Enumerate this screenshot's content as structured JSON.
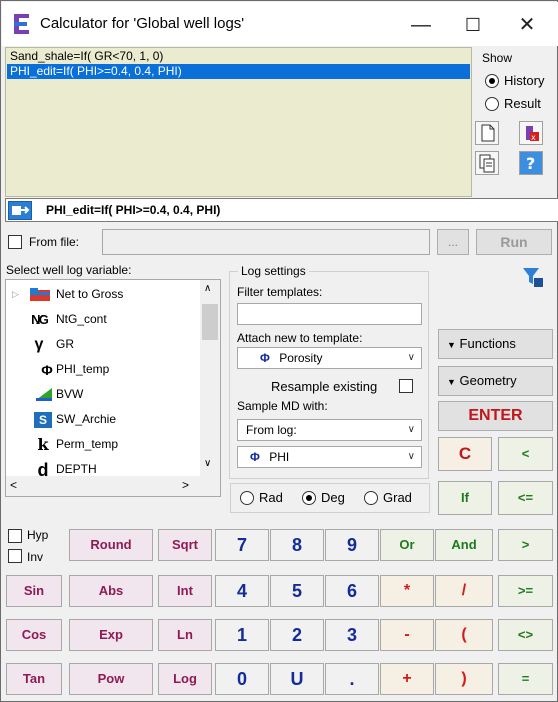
{
  "window": {
    "title": "Calculator for 'Global well logs'",
    "min": "—",
    "max": "☐",
    "close": "✕"
  },
  "formulas": [
    "Sand_shale=If( GR<70, 1, 0)",
    "PHI_edit=If( PHI>=0.4, 0.4, PHI)"
  ],
  "show": {
    "label": "Show",
    "history": "History",
    "result": "Result",
    "selected": "History"
  },
  "expression": "PHI_edit=If( PHI>=0.4, 0.4, PHI)",
  "from_file": {
    "label": "From file:",
    "browse": "...",
    "run": "Run"
  },
  "variables": {
    "label": "Select well log variable:",
    "items": [
      {
        "name": "Net to Gross",
        "icon": "folder-icon"
      },
      {
        "name": "NtG_cont",
        "icon": "ntg-icon"
      },
      {
        "name": "GR",
        "icon": "gamma-icon"
      },
      {
        "name": "PHI_temp",
        "icon": "phi-icon"
      },
      {
        "name": "BVW",
        "icon": "bvw-icon"
      },
      {
        "name": "SW_Archie",
        "icon": "sw-icon"
      },
      {
        "name": "Perm_temp",
        "icon": "perm-icon"
      },
      {
        "name": "DEPTH",
        "icon": "depth-icon"
      }
    ]
  },
  "log_settings": {
    "label": "Log settings",
    "filter_label": "Filter templates:",
    "filter_value": "",
    "attach_label": "Attach new to template:",
    "attach_value": "Porosity",
    "resample_label": "Resample existing",
    "sample_label": "Sample MD with:",
    "sample_value": "From log:",
    "log_value": "PHI"
  },
  "side": {
    "functions": "Functions",
    "geometry": "Geometry",
    "enter": "ENTER"
  },
  "angle": {
    "rad": "Rad",
    "deg": "Deg",
    "grad": "Grad",
    "selected": "Deg"
  },
  "toggles": {
    "hyp": "Hyp",
    "inv": "Inv"
  },
  "keys": {
    "row0": [
      "C",
      "<"
    ],
    "row0b": [
      "If",
      "<="
    ],
    "row1": [
      "Round",
      "Sqrt",
      "7",
      "8",
      "9",
      "Or",
      "And",
      ">"
    ],
    "row2": [
      "Sin",
      "Abs",
      "Int",
      "4",
      "5",
      "6",
      "*",
      "/",
      ">="
    ],
    "row3": [
      "Cos",
      "Exp",
      "Ln",
      "1",
      "2",
      "3",
      "-",
      "(",
      "<>"
    ],
    "row4": [
      "Tan",
      "Pow",
      "Log",
      "0",
      "U",
      ".",
      "+",
      ")",
      "="
    ]
  },
  "colors": {
    "selection": "#0a6fd8",
    "formula_bg": "#ebebcf",
    "enter": "#c0171c",
    "number": "#142b9a"
  }
}
